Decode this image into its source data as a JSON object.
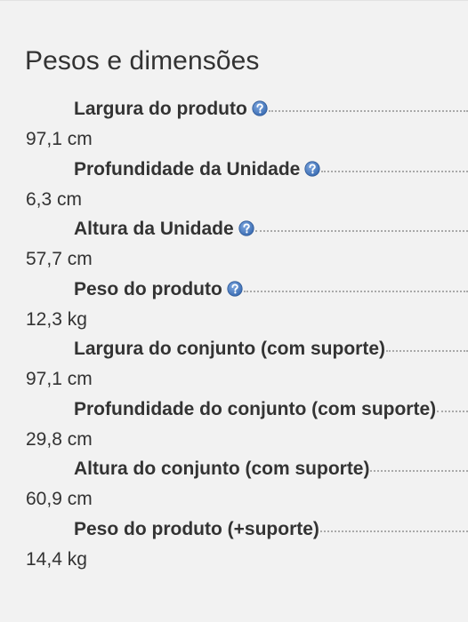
{
  "section": {
    "title": "Pesos e dimensões"
  },
  "specs": [
    {
      "name": "Largura do produto",
      "value": "97,1 cm",
      "has_help_icon": true
    },
    {
      "name": "Profundidade da Unidade",
      "value": "6,3 cm",
      "has_help_icon": true
    },
    {
      "name": "Altura da Unidade",
      "value": "57,7 cm",
      "has_help_icon": true
    },
    {
      "name": "Peso do produto",
      "value": "12,3 kg",
      "has_help_icon": true
    },
    {
      "name": "Largura do conjunto (com suporte)",
      "value": "97,1 cm",
      "has_help_icon": false
    },
    {
      "name": "Profundidade do conjunto (com suporte)",
      "value": "29,8 cm",
      "has_help_icon": false
    },
    {
      "name": "Altura do conjunto (com suporte)",
      "value": "60,9 cm",
      "has_help_icon": false
    },
    {
      "name": "Peso do produto (+suporte)",
      "value": "14,4 kg",
      "has_help_icon": false
    }
  ],
  "icons": {
    "help": "question-circle-icon"
  },
  "colors": {
    "background": "#f2f2f2",
    "text": "#333333",
    "leader_dots": "#a9a9a9",
    "help_icon_blue": "#3b6db3"
  }
}
